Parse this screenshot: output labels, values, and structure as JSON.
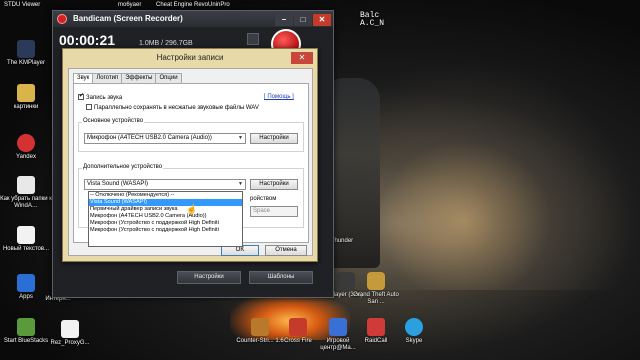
{
  "desktop": {
    "top_strip": [
      "STDU Viewer",
      "mo6yaer",
      "Cheat Engine",
      "RevoUninPro"
    ],
    "balc_text": [
      "Balc",
      "A.C_N"
    ],
    "icons_left": [
      {
        "label": "The KMPlayer",
        "color": "#2c3a5a"
      },
      {
        "label": "картинки",
        "color": "#d9b44a"
      },
      {
        "label": "Yandex",
        "color": "#d23232"
      },
      {
        "label": "Как убрать папки к WindA…",
        "color": "#e8e8e8"
      },
      {
        "label": "Новый текстов...",
        "color": "#f2f2f2"
      },
      {
        "label": "Apps",
        "color": "#2a6fd6"
      },
      {
        "label": "Start BlueStacks",
        "color": "#5a9a3a"
      }
    ],
    "icons_bottom": [
      {
        "label": "Rez_ProxyG...",
        "color": "#f2f2f2"
      },
      {
        "label": "Counter-Stri... 1.6",
        "color": "#b87a2a"
      },
      {
        "label": "Cross Fire",
        "color": "#c43b2b"
      },
      {
        "label": "Игровой центр@Ma...",
        "color": "#3a6fd6"
      },
      {
        "label": "RaidCall",
        "color": "#d23a3a"
      },
      {
        "label": "Skype",
        "color": "#2aa0e0"
      }
    ],
    "icons_right": [
      {
        "label": "Thunder",
        "color": "#4a4a4a"
      },
      {
        "label": "Player (32e)",
        "color": "#3a3a3a"
      },
      {
        "label": "Grand Theft Auto San ...",
        "color": "#c49a3a"
      }
    ],
    "internet_label": "Интерн..."
  },
  "bandicam": {
    "title": "Bandicam (Screen Recorder)",
    "timer": "00:00:21",
    "size": "1.0MB / 296.7GB",
    "settings_btn": "Настройки",
    "templates_btn": "Шаблоны"
  },
  "dialog": {
    "title": "Настройки записи",
    "close": "✕",
    "tabs": [
      "Звук",
      "Логотип",
      "Эффекты",
      "Опции"
    ],
    "record_sound": "Запись звука",
    "parallel_save": "Параллельно сохранять в несжатые звуковые файлы WAV",
    "help": "[ Помощь ]",
    "main_device": {
      "group": "Основное устройство",
      "value": "Микрофон (A4TECH USB2.0 Camera (Audio))",
      "settings": "Настройки"
    },
    "extra_device": {
      "group": "Дополнительное устройство",
      "value": "Vista Sound (WASAPI)",
      "settings": "Настройки",
      "mix_label": "ройством",
      "hotkey": "Space"
    },
    "dropdown": [
      "-- Отключено (Рекомендуется) --",
      "Vista Sound (WASAPI)",
      "Первичный драйвер записи звука",
      "Микрофон (A4TECH USB2.0 Camera (Audio))",
      "Микрофон (Устройство с поддержкой High Definiti",
      "Микрофон (Устройство с поддержкой High Definiti"
    ],
    "ok": "OK",
    "cancel": "Отмена"
  }
}
